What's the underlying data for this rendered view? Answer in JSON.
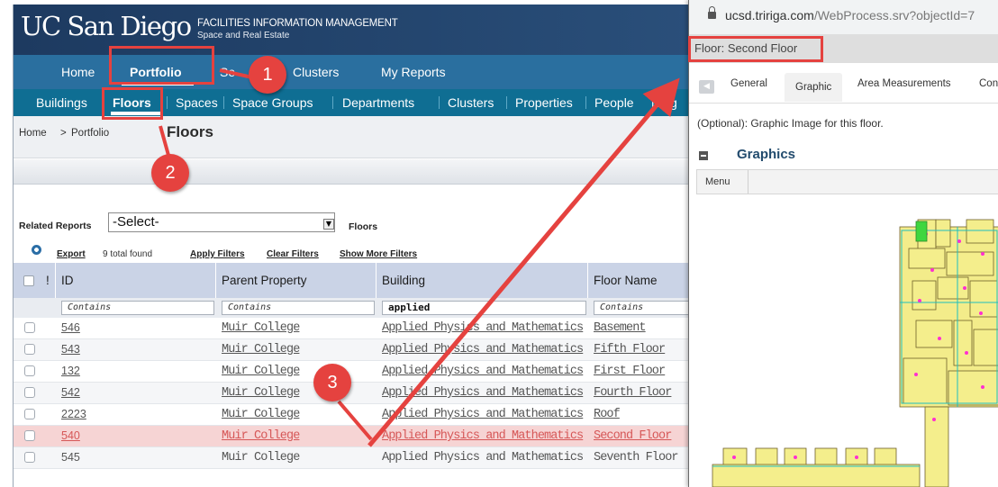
{
  "banner": {
    "logo": "UC San Diego",
    "title": "FACILITIES INFORMATION MANAGEMENT",
    "subtitle": "Space and Real Estate"
  },
  "mainnav": [
    "Home",
    "Portfolio",
    "Se",
    "Clusters",
    "My Reports"
  ],
  "subnav": [
    "Buildings",
    "Floors",
    "Spaces",
    "Space Groups",
    "Departments",
    "Clusters",
    "Properties",
    "People",
    "Neig"
  ],
  "breadcrumb": {
    "home": "Home",
    "sep": ">",
    "portfolio": "Portfolio",
    "current": "Floors"
  },
  "related_reports": {
    "label": "Related Reports",
    "select_value": "-Select-",
    "context": "Floors"
  },
  "actions": {
    "export": "Export",
    "total": "9 total found",
    "apply": "Apply Filters",
    "clear": "Clear Filters",
    "more": "Show More Filters"
  },
  "table": {
    "bang": "!",
    "headers": [
      "ID",
      "Parent Property",
      "Building",
      "Floor Name"
    ],
    "filters": [
      "Contains",
      "Contains",
      "applied",
      "Contains"
    ],
    "rows": [
      {
        "id": "546",
        "property": "Muir College",
        "building": "Applied Physics and Mathematics",
        "floor": "Basement"
      },
      {
        "id": "543",
        "property": "Muir College",
        "building": "Applied Physics and Mathematics",
        "floor": "Fifth Floor"
      },
      {
        "id": "132",
        "property": "Muir College",
        "building": "Applied Physics and Mathematics",
        "floor": "First Floor"
      },
      {
        "id": "542",
        "property": "Muir College",
        "building": "Applied Physics and Mathematics",
        "floor": "Fourth Floor"
      },
      {
        "id": "2223",
        "property": "Muir College",
        "building": "Applied Physics and Mathematics",
        "floor": "Roof"
      },
      {
        "id": "540",
        "property": "Muir College",
        "building": "Applied Physics and Mathematics",
        "floor": "Second Floor"
      },
      {
        "id": "545",
        "property": "Muir College",
        "building": "Applied Physics and Mathematics",
        "floor": "Seventh Floor"
      }
    ]
  },
  "popup": {
    "url_host": "ucsd.tririga.com",
    "url_path": "/WebProcess.srv?objectId=7",
    "title": "Floor: Second Floor",
    "tabs": [
      "General",
      "Graphic",
      "Area Measurements",
      "Con"
    ],
    "description": "(Optional): Graphic Image for this floor.",
    "section": "Graphics",
    "menu": "Menu"
  },
  "annotations": {
    "one": "1",
    "two": "2",
    "three": "3"
  },
  "colors": {
    "annotation": "#e5423f",
    "highlight_row": "#f6d4d4",
    "banner": "#1f3f65",
    "nav": "#2a6f9f"
  }
}
